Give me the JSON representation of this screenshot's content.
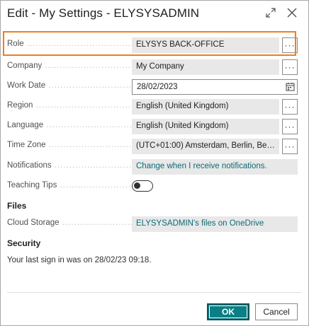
{
  "dialog": {
    "title": "Edit - My Settings - ELYSYSADMIN",
    "expand_icon": "expand-diagonal-arrows",
    "close_icon": "close-x"
  },
  "fields": {
    "role": {
      "label": "Role",
      "value": "ELYSYS BACK-OFFICE",
      "assist": "···"
    },
    "company": {
      "label": "Company",
      "value": "My Company",
      "assist": "···"
    },
    "work_date": {
      "label": "Work Date",
      "value": "28/02/2023",
      "icon": "calendar-icon"
    },
    "region": {
      "label": "Region",
      "value": "English (United Kingdom)",
      "assist": "···"
    },
    "language": {
      "label": "Language",
      "value": "English (United Kingdom)",
      "assist": "···"
    },
    "time_zone": {
      "label": "Time Zone",
      "value": "(UTC+01:00) Amsterdam, Berlin, Bern, Ro...",
      "assist": "···"
    },
    "notifications": {
      "label": "Notifications",
      "value": "Change when I receive notifications."
    },
    "teaching_tips": {
      "label": "Teaching Tips",
      "state": "off"
    }
  },
  "files": {
    "heading": "Files",
    "cloud_storage": {
      "label": "Cloud Storage",
      "value": "ELYSYSADMIN's files on OneDrive"
    }
  },
  "security": {
    "heading": "Security",
    "last_sign_in": "Your last sign in was on 28/02/23 09:18."
  },
  "buttons": {
    "ok": "OK",
    "cancel": "Cancel"
  },
  "colors": {
    "accent": "#0b7f86",
    "highlight": "#f07d1f",
    "link": "#0b6a75"
  }
}
